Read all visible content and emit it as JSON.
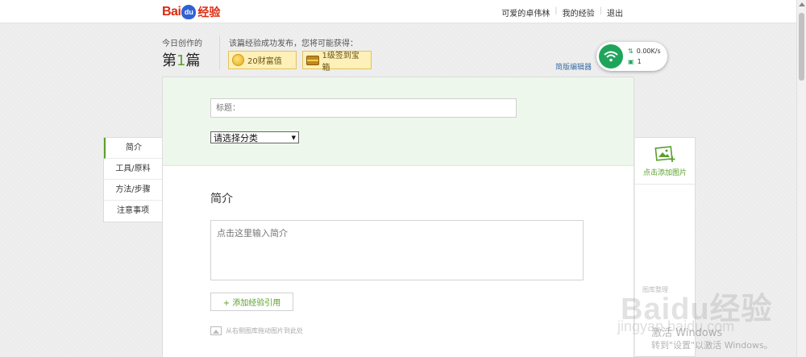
{
  "logo": {
    "bai": "Bai",
    "du": "du",
    "jingyan": "经验"
  },
  "toplinks": {
    "user": "可爱的卓伟林",
    "sep1": "|",
    "my_exp": "我的经验",
    "sep2": "|",
    "logout": "退出"
  },
  "stats": {
    "today_label": "今日创作的",
    "count_prefix": "第",
    "count_num": "1",
    "count_suffix": "篇"
  },
  "rewards": {
    "tip": "该篇经验成功发布，您将可能获得：",
    "wealth": "20财富值",
    "treasure": "1级签到宝箱"
  },
  "simple_editor": "简版编辑器",
  "network": {
    "speed": "0.00K/s",
    "connections": "1"
  },
  "nav": {
    "items": [
      "简介",
      "工具/原料",
      "方法/步骤",
      "注意事项"
    ]
  },
  "form": {
    "title_placeholder": "标题：",
    "category": "请选择分类",
    "section_title": "简介",
    "intro_placeholder": "点击这里输入简介",
    "add_ref": "+ 添加经验引用",
    "drag_hint": "从右侧图库拖动图片到此处"
  },
  "image_panel": {
    "add_label": "点击添加图片",
    "gallery_label": "图库整理"
  },
  "watermark": {
    "brand": "Baidu经验",
    "url": "jingyan.baidu.com"
  },
  "activation": {
    "line1": "激活 Windows",
    "line2": "转到\"设置\"以激活 Windows。"
  },
  "colors": {
    "accent": "#5aa02c",
    "brand_red": "#de2910",
    "wifi_green": "#1fa55b"
  }
}
